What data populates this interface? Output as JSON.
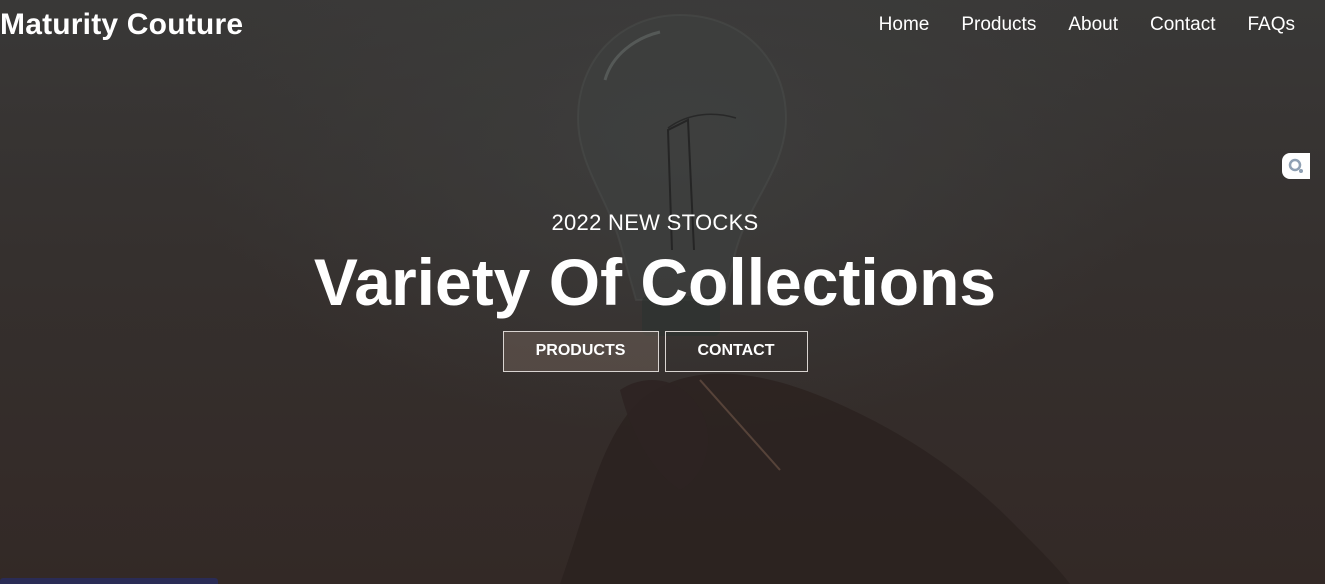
{
  "header": {
    "brand": "Maturity Couture",
    "nav": [
      "Home",
      "Products",
      "About",
      "Contact",
      "FAQs"
    ]
  },
  "hero": {
    "eyebrow": "2022 NEW STOCKS",
    "headline": "Variety Of Collections",
    "buttons": {
      "products": "PRODUCTS",
      "contact": "CONTACT"
    }
  },
  "widget": {
    "icon": "search-bubble-icon"
  },
  "colors": {
    "text": "#ffffff",
    "background": "#363230",
    "button_border": "#d9d4d1"
  }
}
